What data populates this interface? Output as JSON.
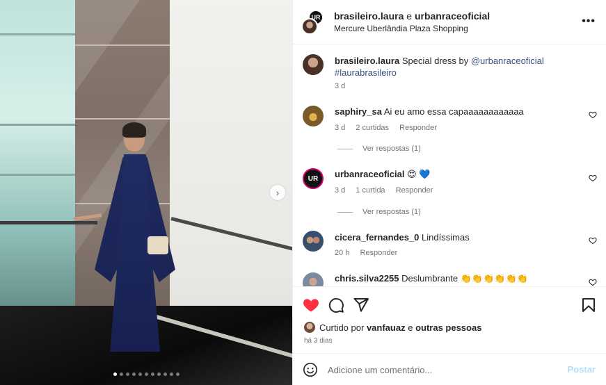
{
  "header": {
    "user1": "brasileiro.laura",
    "and": "e",
    "user2": "urbanraceoficial",
    "location": "Mercure Uberlândia Plaza Shopping",
    "more_icon": "more-horizontal-icon",
    "more_label": "•••"
  },
  "carousel": {
    "next_label": "›",
    "dot_count": 11,
    "active_dot": 0
  },
  "caption": {
    "user": "brasileiro.laura",
    "text": "Special dress by ",
    "mention": "@urbanraceoficial",
    "hashtag": "#laurabrasileiro",
    "time": "3 d"
  },
  "comments": [
    {
      "user": "saphiry_sa",
      "text": "Ai eu amo essa capaaaaaaaaaaaa",
      "time": "3 d",
      "likes": "2 curtidas",
      "reply_label": "Responder",
      "view_replies": "Ver respostas (1)"
    },
    {
      "user": "urbanraceoficial",
      "text": "😍 💙",
      "time": "3 d",
      "likes": "1 curtida",
      "reply_label": "Responder",
      "view_replies": "Ver respostas (1)"
    },
    {
      "user": "cicera_fernandes_0",
      "text": "Lindíssimas",
      "time": "20 h",
      "reply_label": "Responder"
    },
    {
      "user": "chris.silva2255",
      "text": "Deslumbrante 👏👏👏👏👏👏"
    }
  ],
  "actions": {
    "like_icon": "heart-filled-icon",
    "comment_icon": "comment-icon",
    "share_icon": "share-icon",
    "save_icon": "bookmark-icon",
    "liked_by_prefix": "Curtido por",
    "liked_by_user": "vanfauaz",
    "liked_by_and": "e",
    "liked_by_others": "outras pessoas",
    "time_ago": "há 3 dias"
  },
  "add_comment": {
    "placeholder": "Adicione um comentário...",
    "post_label": "Postar",
    "emoji_icon": "emoji-icon"
  },
  "colors": {
    "like_red": "#ff3040",
    "link_blue": "#385185",
    "post_disabled": "#b2dffc",
    "muted": "#737373"
  }
}
